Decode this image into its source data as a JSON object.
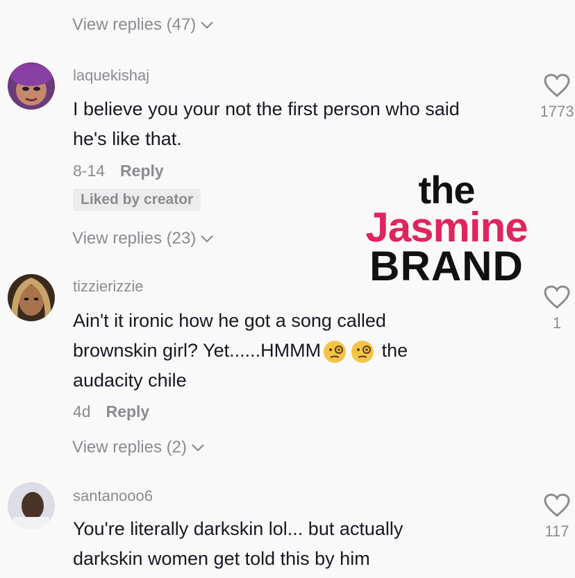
{
  "thread": {
    "view_replies_top": "View replies (47)"
  },
  "comments": [
    {
      "username": "laquekishaj",
      "text": "I believe you your not the first person who said he's like that.",
      "date": "8-14",
      "reply_label": "Reply",
      "badge": "Liked by creator",
      "likes": "1773",
      "view_replies": "View replies (23)"
    },
    {
      "username": "tizzierizzie",
      "text_before": "Ain't it ironic how he got a song called brownskin girl? Yet......HMMM",
      "text_after": " the audacity chile",
      "emoji": "face-with-monocle",
      "date": "4d",
      "reply_label": "Reply",
      "likes": "1",
      "view_replies": "View replies (2)"
    },
    {
      "username": "santanooo6",
      "text": "You're literally darkskin lol... but actually darkskin women get told this by him",
      "likes": "117"
    }
  ],
  "watermark": {
    "line1": "the",
    "line2": "Jasmine",
    "line3": "BRAND"
  },
  "colors": {
    "secondary_text": "#8a8b91",
    "primary_text": "#161823",
    "watermark_accent": "#e0245e"
  }
}
